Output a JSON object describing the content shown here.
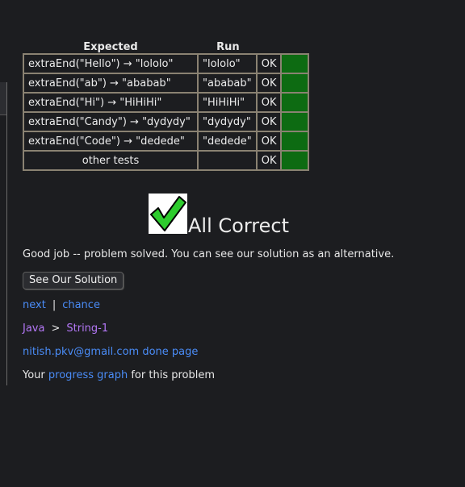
{
  "table": {
    "headers": {
      "expected": "Expected",
      "run": "Run"
    },
    "rows": [
      {
        "expected": "extraEnd(\"Hello\") → \"lololo\"",
        "run": "\"lololo\"",
        "status": "OK"
      },
      {
        "expected": "extraEnd(\"ab\") → \"ababab\"",
        "run": "\"ababab\"",
        "status": "OK"
      },
      {
        "expected": "extraEnd(\"Hi\") → \"HiHiHi\"",
        "run": "\"HiHiHi\"",
        "status": "OK"
      },
      {
        "expected": "extraEnd(\"Candy\") → \"dydydy\"",
        "run": "\"dydydy\"",
        "status": "OK"
      },
      {
        "expected": "extraEnd(\"Code\") → \"dedede\"",
        "run": "\"dedede\"",
        "status": "OK"
      },
      {
        "expected": "other tests",
        "run": "",
        "status": "OK"
      }
    ],
    "pass_color": "#0d6b12"
  },
  "result": {
    "title": "All Correct",
    "message": "Good job -- problem solved. You can see our solution as an alternative.",
    "check_icon": "checkmark-icon",
    "check_color": "#2ecc2e"
  },
  "solution_button": "See Our Solution",
  "nav": {
    "next": "next",
    "separator": "|",
    "chance": "chance"
  },
  "breadcrumb": {
    "language": "Java",
    "separator": ">",
    "section": "String-1"
  },
  "user": {
    "email": "nitish.pkv@gmail.com",
    "done_page": "done page"
  },
  "progress": {
    "prefix": "Your",
    "link": "progress graph",
    "suffix": "for this problem"
  }
}
